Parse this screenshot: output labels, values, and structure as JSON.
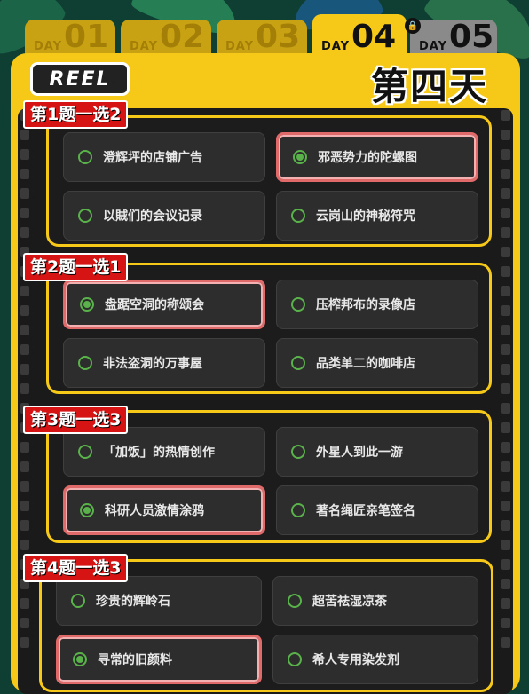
{
  "tabs": [
    {
      "prefix": "DAY",
      "num": "01"
    },
    {
      "prefix": "DAY",
      "num": "02"
    },
    {
      "prefix": "DAY",
      "num": "03"
    },
    {
      "prefix": "DAY",
      "num": "04"
    },
    {
      "prefix": "DAY",
      "num": "05"
    }
  ],
  "logo": "REEL",
  "day_title": "第四天",
  "questions": [
    {
      "tag": "第1题一选2",
      "options": [
        "澄辉坪的店铺广告",
        "邪恶势力的陀螺图",
        "以賊们的会议记录",
        "云岗山的神秘符咒"
      ],
      "selected": [
        1
      ]
    },
    {
      "tag": "第2题一选1",
      "options": [
        "盘踞空洞的称颂会",
        "压榨邦布的录像店",
        "非法盗洞的万事屋",
        "品类单二的咖啡店"
      ],
      "selected": [
        0
      ]
    },
    {
      "tag": "第3题一选3",
      "options": [
        "「加饭」的热情创作",
        "外星人到此一游",
        "科研人员激情涂鸦",
        "著名绳匠亲笔签名"
      ],
      "selected": [
        2
      ]
    },
    {
      "tag": "第4题一选3",
      "options": [
        "珍贵的辉岭石",
        "超苦祛湿凉茶",
        "寻常的旧颜料",
        "希人专用染发剂"
      ],
      "selected": [
        2
      ]
    }
  ],
  "colors": {
    "accent": "#f6c919",
    "tag_red": "#d61414",
    "radio_green": "#59b24a",
    "selected_border": "#e06a6a"
  }
}
